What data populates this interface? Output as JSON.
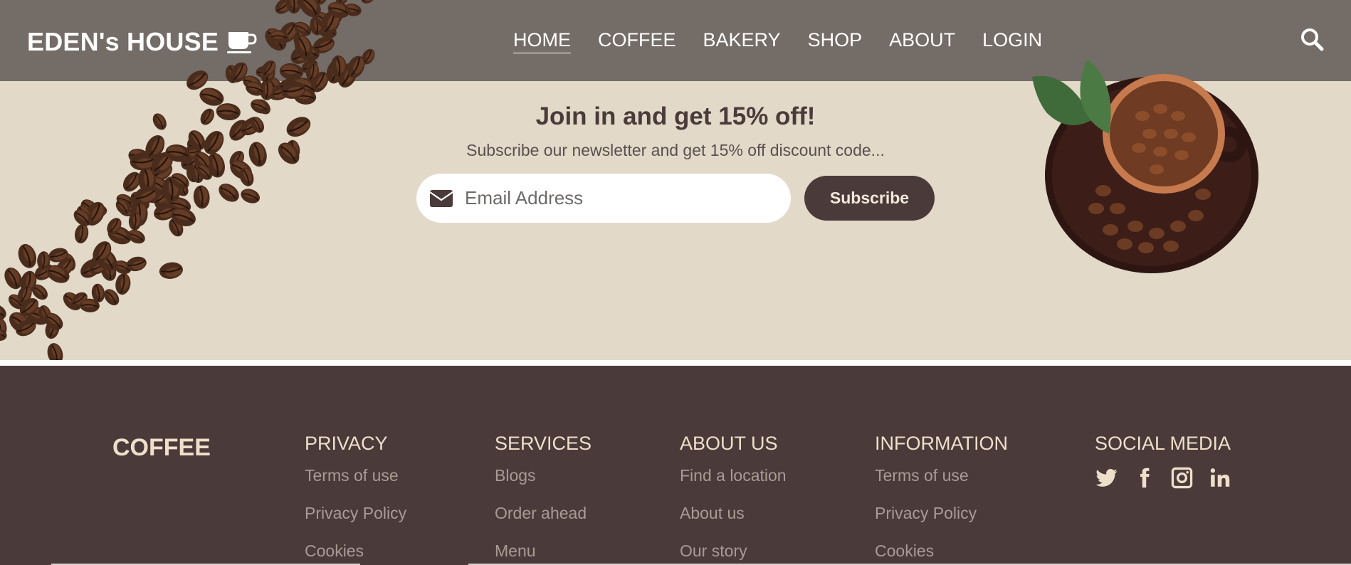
{
  "header": {
    "logo_text": "EDEN's HOUSE",
    "nav": [
      {
        "label": "HOME",
        "active": true
      },
      {
        "label": "COFFEE"
      },
      {
        "label": "BAKERY"
      },
      {
        "label": "SHOP"
      },
      {
        "label": "ABOUT"
      },
      {
        "label": "LOGIN"
      }
    ]
  },
  "newsletter": {
    "title": "Join in and get 15% off!",
    "subtitle": "Subscribe our newsletter and get 15% off discount code...",
    "email_placeholder": "Email Address",
    "button_label": "Subscribe"
  },
  "footer": {
    "brand": "COFFEE",
    "columns": [
      {
        "title": "PRIVACY",
        "links": [
          "Terms of use",
          "Privacy Policy",
          "Cookies"
        ]
      },
      {
        "title": "SERVICES",
        "links": [
          "Blogs",
          "Order ahead",
          "Menu"
        ]
      },
      {
        "title": "ABOUT US",
        "links": [
          "Find a location",
          "About us",
          "Our story"
        ]
      },
      {
        "title": "INFORMATION",
        "links": [
          "Terms of use",
          "Privacy Policy",
          "Cookies"
        ]
      }
    ],
    "social_title": "SOCIAL MEDIA",
    "social_icons": [
      "twitter-icon",
      "facebook-icon",
      "instagram-icon",
      "linkedin-icon"
    ]
  },
  "colors": {
    "header_bg": "#746c67",
    "newsletter_bg": "#e2d9c8",
    "footer_bg": "#4a3a3a",
    "accent_dark": "#4a3a3a",
    "footer_heading": "#eedfca",
    "footer_link": "#a99b94"
  }
}
